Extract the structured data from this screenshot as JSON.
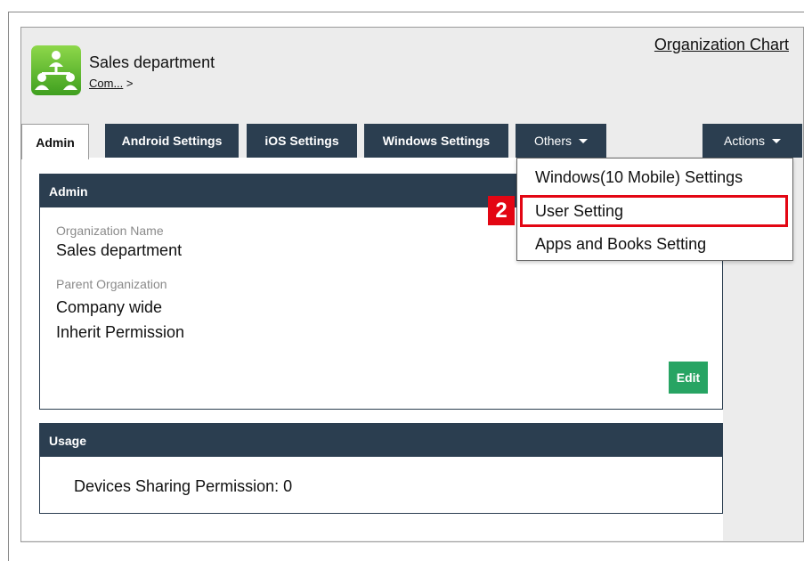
{
  "header": {
    "org_title": "Sales department",
    "breadcrumb_link": "Com...",
    "breadcrumb_separator": " >",
    "org_chart_link": "Organization Chart",
    "app_icon": "organization-tree-icon"
  },
  "tabs": {
    "admin": "Admin",
    "android": "Android Settings",
    "ios": "iOS Settings",
    "windows": "Windows Settings",
    "others": "Others",
    "actions": "Actions"
  },
  "admin_panel": {
    "title": "Admin",
    "org_name_label": "Organization Name",
    "org_name_value": "Sales department",
    "parent_org_label": "Parent Organization",
    "parent_org_value": "Company wide",
    "inherit_value": "Inherit Permission",
    "edit_label": "Edit"
  },
  "usage_panel": {
    "title": "Usage",
    "devices_sharing": "Devices Sharing Permission: 0"
  },
  "others_menu": {
    "items": [
      "Windows(10 Mobile) Settings",
      "User Setting",
      "Apps and Books Setting"
    ],
    "highlighted_index": 1
  },
  "annotation": {
    "step_number": "2",
    "color": "#e30613"
  },
  "colors": {
    "tab_dark": "#2b3e50",
    "edit_green": "#27a463",
    "icon_green": "#5cb82e"
  }
}
